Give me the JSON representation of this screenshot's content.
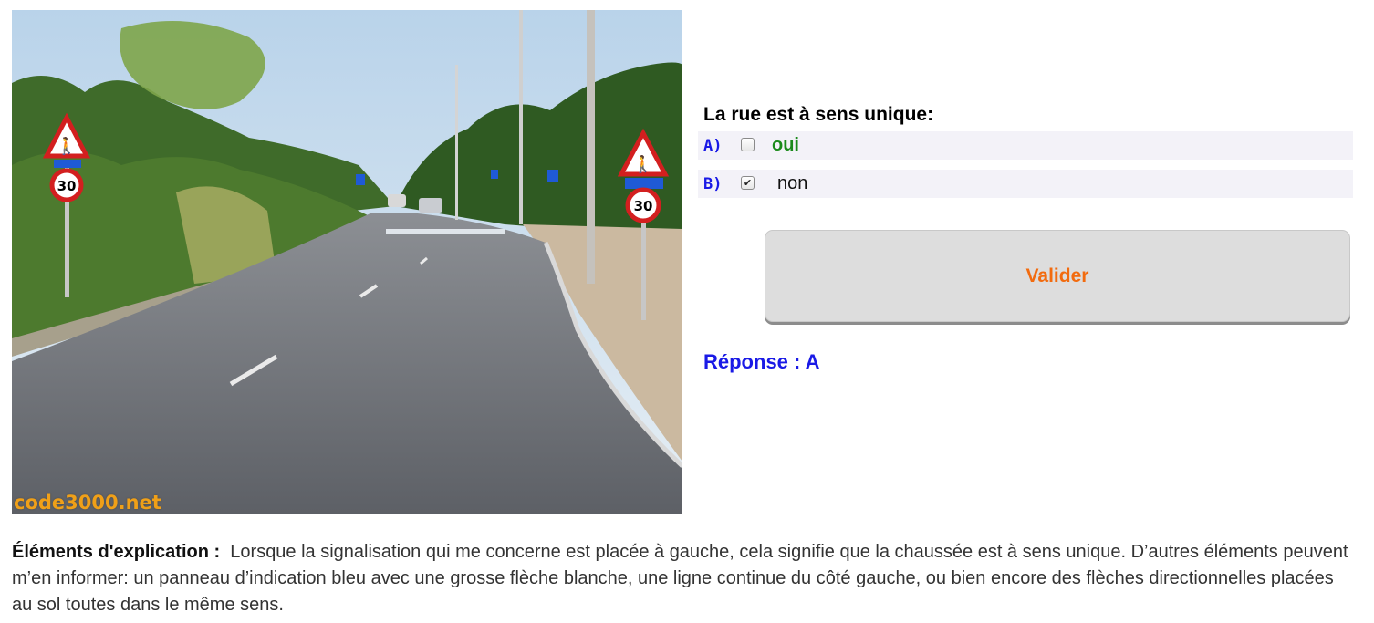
{
  "photo": {
    "watermark": "code3000.net",
    "speed_limit": "30"
  },
  "question": {
    "title": "La rue est à sens unique:",
    "answers": [
      {
        "letter": "A)",
        "text": "oui",
        "checked": false
      },
      {
        "letter": "B)",
        "text": "non",
        "checked": true
      }
    ]
  },
  "actions": {
    "validate_label": "Valider"
  },
  "response": {
    "text": "Réponse : A"
  },
  "explanation": {
    "label": "Éléments d'explication :",
    "text": "Lorsque la signalisation qui me concerne est placée à gauche, cela signifie que la chaussée est à sens unique. D’autres éléments peuvent m’en informer: un panneau d’indication bleu avec une grosse flèche blanche, une ligne continue du côté gauche, ou bien encore des flèches directionnelles placées au sol toutes dans le même sens."
  },
  "colors": {
    "answer_letter": "#1a1ae6",
    "answer_a_text": "#1a8a1a",
    "validate_text": "#f26b0f",
    "response_text": "#1a1ae6",
    "row_background": "#f3f2f8"
  }
}
